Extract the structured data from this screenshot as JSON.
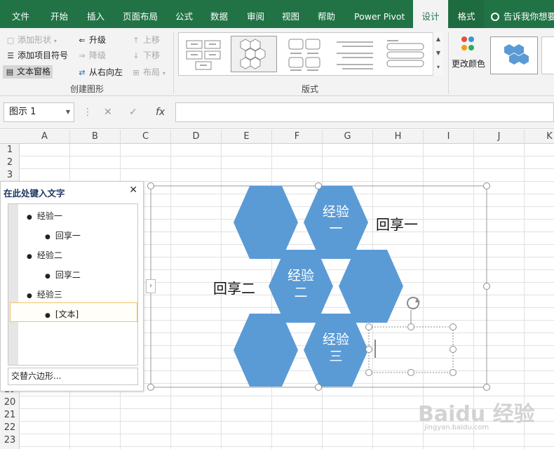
{
  "tabs": [
    "文件",
    "开始",
    "插入",
    "页面布局",
    "公式",
    "数据",
    "审阅",
    "视图",
    "帮助",
    "Power Pivot",
    "设计",
    "格式"
  ],
  "tell_me": "告诉我你想要",
  "ribbon": {
    "create_group": {
      "add_shape": "添加形状",
      "add_bullet": "添加项目符号",
      "text_pane": "文本窗格",
      "promote": "升级",
      "demote": "降级",
      "right_to_left": "从右向左",
      "move_up": "上移",
      "move_down": "下移",
      "layout": "布局",
      "label": "创建图形"
    },
    "layouts_label": "版式",
    "change_colors": "更改颜色"
  },
  "formula_bar": {
    "name_box": "图示 1",
    "fx": "fx"
  },
  "columns": [
    "A",
    "B",
    "C",
    "D",
    "E",
    "F",
    "G",
    "H",
    "I",
    "J",
    "K"
  ],
  "rows": [
    "1",
    "2",
    "3",
    "19",
    "20",
    "21",
    "22",
    "23"
  ],
  "text_pane": {
    "title": "在此处键入文字",
    "items": [
      {
        "text": "经验一",
        "level": 1
      },
      {
        "text": "回享一",
        "level": 2
      },
      {
        "text": "经验二",
        "level": 1
      },
      {
        "text": "回享二",
        "level": 2
      },
      {
        "text": "经验三",
        "level": 1
      },
      {
        "text": "[文本]",
        "level": 2
      }
    ],
    "footer": "交替六边形..."
  },
  "smartart": {
    "hex_labels": [
      "经验\n一",
      "经验\n二",
      "经验\n三"
    ],
    "side_labels": [
      "回享一",
      "回享二"
    ],
    "fill": "#5b9bd5"
  },
  "watermark": {
    "main": "Baidu 经验",
    "sub": "jingyan.baidu.com"
  },
  "colors": {
    "excel_green": "#217346",
    "accent": "#5b9bd5"
  }
}
